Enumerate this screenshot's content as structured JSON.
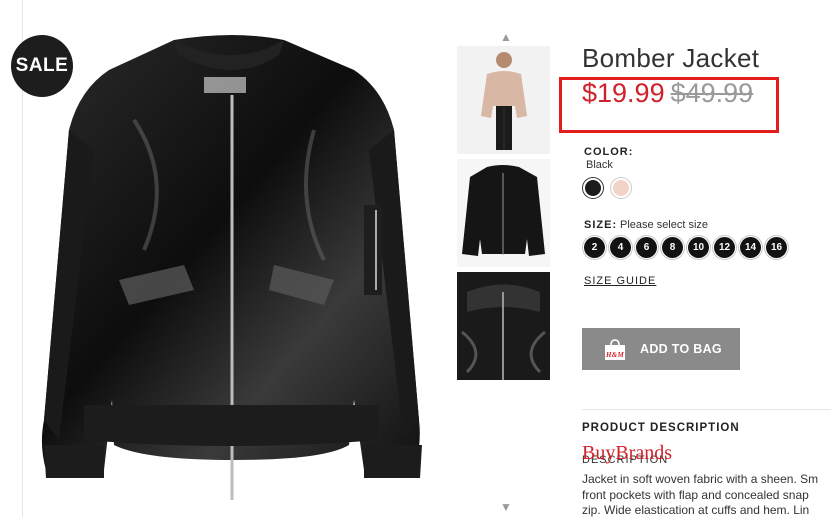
{
  "badge": {
    "sale": "SALE"
  },
  "product": {
    "title": "Bomber Jacket",
    "sale_price": "$19.99",
    "original_price": "$49.99"
  },
  "color": {
    "label": "COLOR:",
    "selected": "Black",
    "swatches": [
      {
        "name": "black",
        "hex": "#1b1b1b"
      },
      {
        "name": "pink",
        "hex": "#f1d3c8"
      }
    ]
  },
  "size": {
    "label": "SIZE:",
    "hint": "Please select size",
    "options": [
      "2",
      "4",
      "6",
      "8",
      "10",
      "12",
      "14",
      "16"
    ],
    "guide_label": "SIZE GUIDE"
  },
  "actions": {
    "add_to_bag": "ADD TO BAG",
    "bag_logo": "H&M"
  },
  "description": {
    "heading": "PRODUCT DESCRIPTION",
    "subheading": "DESCRIPTION",
    "line1": "Jacket in soft woven fabric with a sheen. Sm",
    "line2": "front pockets with flap and concealed snap",
    "line3": "zip. Wide elastication at cuffs and hem. Lin"
  },
  "watermark": "BuyBrands",
  "colors": {
    "sale_red": "#d0222a",
    "highlight_red": "#e31c1c",
    "button_gray": "#8a8a8a"
  },
  "icons": {
    "up": "chevron-up-icon",
    "down": "chevron-down-icon",
    "bag": "shopping-bag-icon"
  }
}
